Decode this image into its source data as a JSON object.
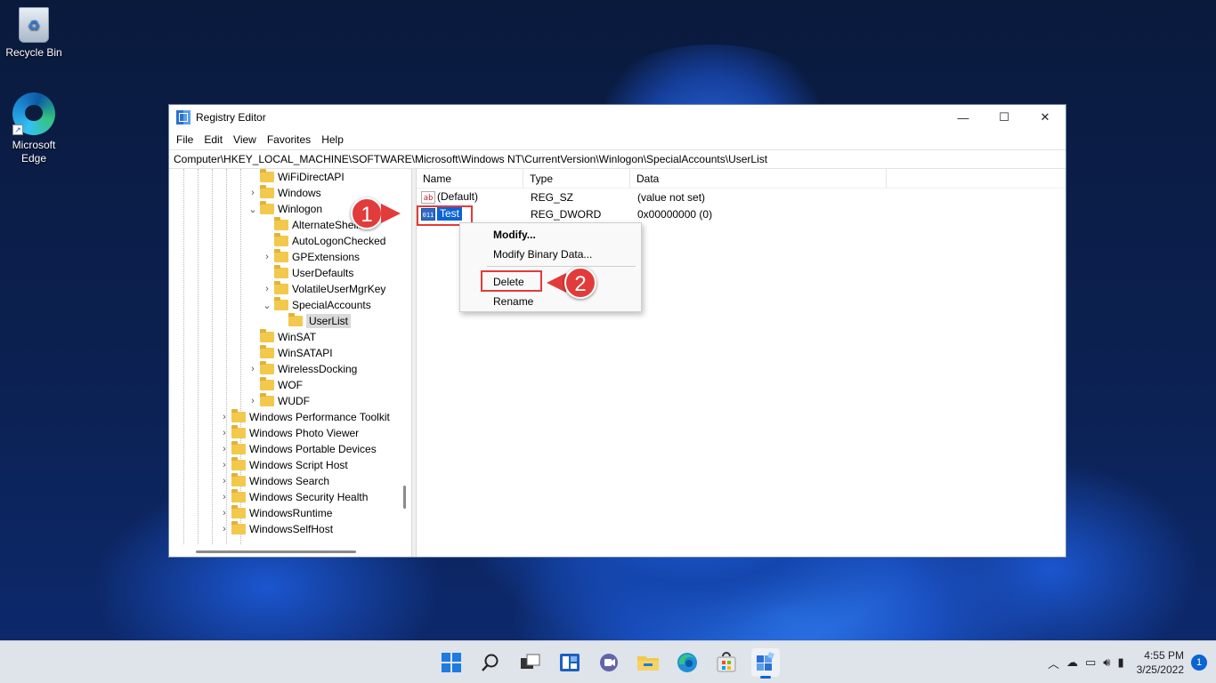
{
  "desktop": {
    "icons": [
      {
        "label": "Recycle Bin",
        "icon": "recycle-bin-icon"
      },
      {
        "label": "Microsoft Edge",
        "icon": "edge-icon"
      }
    ]
  },
  "window": {
    "title": "Registry Editor",
    "controls": {
      "minimize": "—",
      "maximize": "☐",
      "close": "✕"
    },
    "menu": [
      "File",
      "Edit",
      "View",
      "Favorites",
      "Help"
    ],
    "address": "Computer\\HKEY_LOCAL_MACHINE\\SOFTWARE\\Microsoft\\Windows NT\\CurrentVersion\\Winlogon\\SpecialAccounts\\UserList"
  },
  "tree": [
    {
      "label": "WiFiDirectAPI",
      "level": 1,
      "expander": ""
    },
    {
      "label": "Windows",
      "level": 1,
      "expander": "›"
    },
    {
      "label": "Winlogon",
      "level": 1,
      "expander": "⌄"
    },
    {
      "label": "AlternateShells",
      "level": 2,
      "expander": ""
    },
    {
      "label": "AutoLogonChecked",
      "level": 2,
      "expander": ""
    },
    {
      "label": "GPExtensions",
      "level": 2,
      "expander": "›"
    },
    {
      "label": "UserDefaults",
      "level": 2,
      "expander": ""
    },
    {
      "label": "VolatileUserMgrKey",
      "level": 2,
      "expander": "›"
    },
    {
      "label": "SpecialAccounts",
      "level": 2,
      "expander": "⌄"
    },
    {
      "label": "UserList",
      "level": 3,
      "expander": "",
      "selected": true
    },
    {
      "label": "WinSAT",
      "level": 1,
      "expander": ""
    },
    {
      "label": "WinSATAPI",
      "level": 1,
      "expander": ""
    },
    {
      "label": "WirelessDocking",
      "level": 1,
      "expander": "›"
    },
    {
      "label": "WOF",
      "level": 1,
      "expander": ""
    },
    {
      "label": "WUDF",
      "level": 1,
      "expander": "›"
    },
    {
      "label": "Windows Performance Toolkit",
      "level": 0,
      "expander": "›"
    },
    {
      "label": "Windows Photo Viewer",
      "level": 0,
      "expander": "›"
    },
    {
      "label": "Windows Portable Devices",
      "level": 0,
      "expander": "›"
    },
    {
      "label": "Windows Script Host",
      "level": 0,
      "expander": "›"
    },
    {
      "label": "Windows Search",
      "level": 0,
      "expander": "›"
    },
    {
      "label": "Windows Security Health",
      "level": 0,
      "expander": "›"
    },
    {
      "label": "WindowsRuntime",
      "level": 0,
      "expander": "›"
    },
    {
      "label": "WindowsSelfHost",
      "level": 0,
      "expander": "›"
    }
  ],
  "list": {
    "columns": [
      "Name",
      "Type",
      "Data"
    ],
    "rows": [
      {
        "name": "(Default)",
        "type": "REG_SZ",
        "data": "(value not set)",
        "icon": "string-value-icon",
        "icon_text": "ab"
      },
      {
        "name": "Test",
        "type": "REG_DWORD",
        "data": "0x00000000 (0)",
        "icon": "binary-value-icon",
        "icon_text": "011\n110",
        "selected": true
      }
    ]
  },
  "context_menu": {
    "items": [
      {
        "label": "Modify...",
        "bold": true
      },
      {
        "label": "Modify Binary Data..."
      },
      {
        "label": "Delete",
        "highlighted": true
      },
      {
        "label": "Rename"
      }
    ]
  },
  "callouts": [
    {
      "number": "1",
      "target": "Test"
    },
    {
      "number": "2",
      "target": "Delete"
    }
  ],
  "taskbar": {
    "apps": [
      "start-icon",
      "search-icon",
      "task-view-icon",
      "widgets-icon",
      "teams-chat-icon",
      "file-explorer-icon",
      "edge-icon",
      "store-icon",
      "registry-editor-icon"
    ],
    "tray": {
      "chevron": "︿",
      "icons": [
        "onedrive-icon",
        "network-icon",
        "volume-icon",
        "battery-icon"
      ],
      "time": "4:55 PM",
      "date": "3/25/2022",
      "notifications": "1"
    }
  },
  "colors": {
    "accent": "#0a64d4",
    "callout": "#e23b3b",
    "folder": "#f2c94c"
  }
}
